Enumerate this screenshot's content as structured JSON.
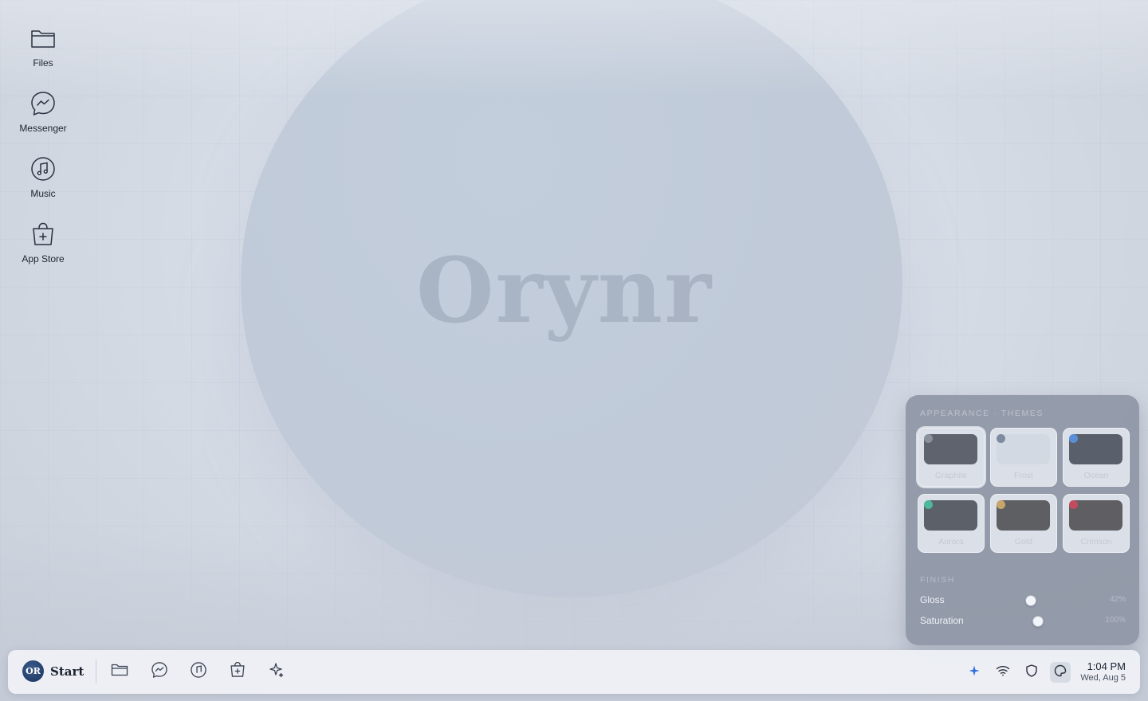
{
  "desktop": {
    "wordmark": "Orynr",
    "icons": [
      {
        "label": "Files",
        "icon": "folder-icon"
      },
      {
        "label": "Messenger",
        "icon": "messenger-icon"
      },
      {
        "label": "Music",
        "icon": "music-icon"
      },
      {
        "label": "App Store",
        "icon": "app-store-icon"
      }
    ]
  },
  "taskbar": {
    "start_logo": "OR",
    "start_label": "Start",
    "pinned": [
      "folder-icon",
      "messenger-icon",
      "music-icon",
      "app-store-icon",
      "sparkle-icon"
    ],
    "tray": [
      "sparkle-icon",
      "wifi-icon",
      "shield-icon",
      "theme-icon"
    ],
    "clock_time": "1:04 PM",
    "clock_date": "Wed, Aug 5"
  },
  "appearance_panel": {
    "title": "APPEARANCE · THEMES",
    "themes": [
      {
        "name": "Graphite",
        "swatch": "#5e636d",
        "dot": "#8a909c",
        "selected": true
      },
      {
        "name": "Frost",
        "swatch": "#d3d9e3",
        "dot": "#7e8aa0",
        "selected": false
      },
      {
        "name": "Ocean",
        "swatch": "#5a606b",
        "dot": "#5b8fd6",
        "selected": false
      },
      {
        "name": "Aurora",
        "swatch": "#5c6169",
        "dot": "#4fb79a",
        "selected": false
      },
      {
        "name": "Gold",
        "swatch": "#5e5f63",
        "dot": "#c8a66a",
        "selected": false
      },
      {
        "name": "Crimson",
        "swatch": "#5f5e63",
        "dot": "#c04c5e",
        "selected": false
      }
    ],
    "finish_title": "FINISH",
    "sliders": [
      {
        "label": "Gloss",
        "value_text": "42%",
        "value": 0.42
      },
      {
        "label": "Saturation",
        "value_text": "100%",
        "value": 1.0
      }
    ]
  },
  "colors": {
    "accent": "#2f6fe0",
    "brand_logo": "#1c3460"
  }
}
